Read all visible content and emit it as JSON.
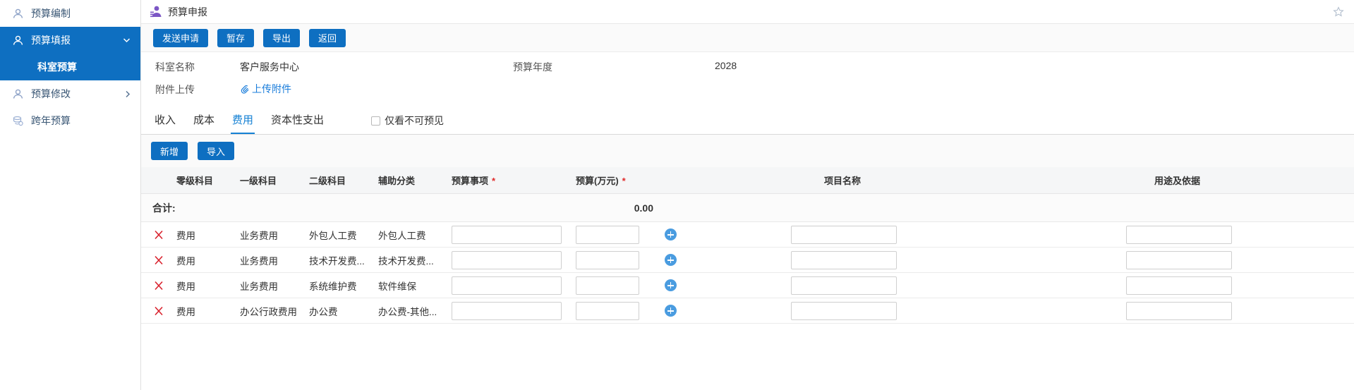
{
  "colors": {
    "accent": "#0e6fc1",
    "tab_active": "#1581d4",
    "link": "#1a7ddb",
    "plus_icon": "#4a9ce0",
    "delete_icon": "#d9232e",
    "required_asterisk": "#e02b2b",
    "header_icon_purple": "#7c57c5",
    "star_outline": "#b3bfce"
  },
  "sidebar": {
    "items": [
      {
        "label": "预算编制",
        "icon": "user-icon"
      },
      {
        "label": "预算填报",
        "icon": "user-icon",
        "chevron": "down",
        "active": true
      },
      {
        "label": "科室预算",
        "sub_item": true,
        "active": true
      },
      {
        "label": "预算修改",
        "icon": "user-icon",
        "chevron": "right"
      },
      {
        "label": "跨年预算",
        "icon": "coins-icon"
      }
    ]
  },
  "header": {
    "title": "预算申报"
  },
  "toolbar": {
    "buttons": [
      {
        "label": "发送申请"
      },
      {
        "label": "暂存"
      },
      {
        "label": "导出"
      },
      {
        "label": "返回"
      }
    ]
  },
  "form": {
    "dept_label": "科室名称",
    "dept_value": "客户服务中心",
    "year_label": "预算年度",
    "year_value": "2028",
    "attach_label": "附件上传",
    "attach_link": "上传附件"
  },
  "tabs": {
    "items": [
      {
        "label": "收入"
      },
      {
        "label": "成本"
      },
      {
        "label": "费用",
        "active": true
      },
      {
        "label": "资本性支出"
      }
    ],
    "checkbox_label": "仅看不可预见",
    "checkbox_checked": false
  },
  "actions": {
    "add_label": "新增",
    "import_label": "导入"
  },
  "table": {
    "headers": {
      "level0": "零级科目",
      "level1": "一级科目",
      "level2": "二级科目",
      "aux": "辅助分类",
      "item": "预算事项",
      "amount": "预算(万元)",
      "project": "项目名称",
      "usage": "用途及依据"
    },
    "required_mark": "*",
    "total_label": "合计:",
    "total_value": "0.00",
    "rows": [
      {
        "level0": "费用",
        "level1": "业务费用",
        "level2": "外包人工费",
        "aux": "外包人工费"
      },
      {
        "level0": "费用",
        "level1": "业务费用",
        "level2": "技术开发费...",
        "aux": "技术开发费..."
      },
      {
        "level0": "费用",
        "level1": "业务费用",
        "level2": "系统维护费",
        "aux": "软件维保"
      },
      {
        "level0": "费用",
        "level1": "办公行政费用",
        "level2": "办公费",
        "aux": "办公费-其他..."
      }
    ]
  }
}
